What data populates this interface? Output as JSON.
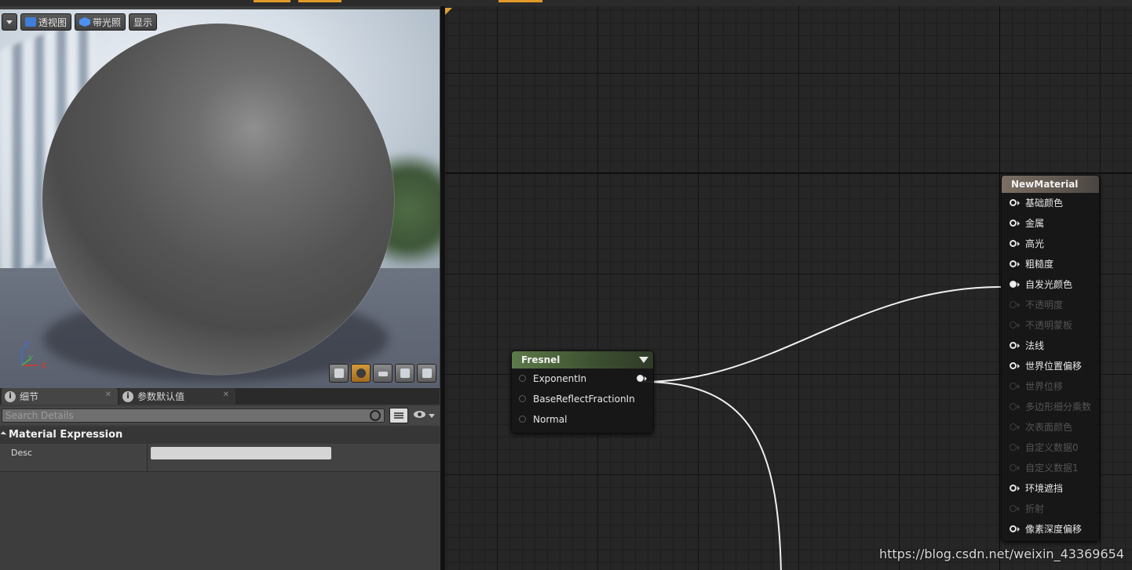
{
  "viewport": {
    "toolbar": {
      "perspective_label": "透视图",
      "lit_label": "带光照",
      "show_label": "显示"
    },
    "axis_labels": {
      "z": "Z",
      "y": "Y",
      "x": "X"
    },
    "preview_shapes": [
      "cylinder-icon",
      "sphere-icon",
      "plane-icon",
      "cube-icon",
      "custom-mesh-icon"
    ],
    "active_shape": "sphere-icon"
  },
  "details_panel": {
    "tabs": [
      {
        "label": "细节",
        "icon": "info-icon",
        "active": true
      },
      {
        "label": "参数默认值",
        "icon": "info-icon",
        "active": false
      }
    ],
    "search_placeholder": "Search Details",
    "category": "Material Expression",
    "properties": [
      {
        "label": "Desc",
        "value": ""
      }
    ]
  },
  "graph": {
    "accent_color": "#e2a12e",
    "nodes": {
      "fresnel": {
        "title": "Fresnel",
        "title_color": "#5c7a4a",
        "inputs": [
          "ExponentIn",
          "BaseReflectFractionIn",
          "Normal"
        ]
      },
      "new_material": {
        "title": "NewMaterial",
        "title_color": "#7b6f63",
        "inputs": [
          {
            "label": "基础颜色",
            "enabled": true,
            "connected": false
          },
          {
            "label": "金属",
            "enabled": true,
            "connected": false
          },
          {
            "label": "高光",
            "enabled": true,
            "connected": false
          },
          {
            "label": "粗糙度",
            "enabled": true,
            "connected": false
          },
          {
            "label": "自发光颜色",
            "enabled": true,
            "connected": true
          },
          {
            "label": "不透明度",
            "enabled": false,
            "connected": false
          },
          {
            "label": "不透明蒙板",
            "enabled": false,
            "connected": false
          },
          {
            "label": "法线",
            "enabled": true,
            "connected": false
          },
          {
            "label": "世界位置偏移",
            "enabled": true,
            "connected": false
          },
          {
            "label": "世界位移",
            "enabled": false,
            "connected": false
          },
          {
            "label": "多边形细分乘数",
            "enabled": false,
            "connected": false
          },
          {
            "label": "次表面颜色",
            "enabled": false,
            "connected": false
          },
          {
            "label": "自定义数据0",
            "enabled": false,
            "connected": false
          },
          {
            "label": "自定义数据1",
            "enabled": false,
            "connected": false
          },
          {
            "label": "环境遮挡",
            "enabled": true,
            "connected": false
          },
          {
            "label": "折射",
            "enabled": false,
            "connected": false
          },
          {
            "label": "像素深度偏移",
            "enabled": true,
            "connected": false
          }
        ]
      }
    }
  },
  "watermark": "https://blog.csdn.net/weixin_43369654"
}
